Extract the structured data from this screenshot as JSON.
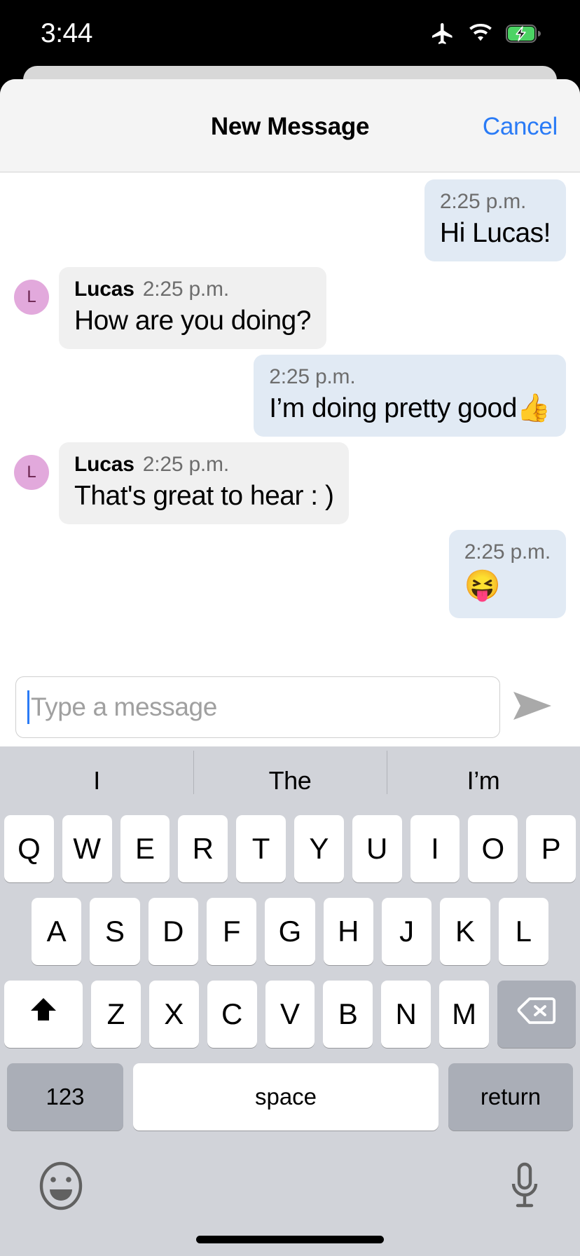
{
  "status_bar": {
    "time": "3:44",
    "icons": [
      "airplane-mode-icon",
      "wifi-icon",
      "battery-charging-icon"
    ],
    "battery_color": "#4cd364"
  },
  "sheet": {
    "title": "New Message",
    "cancel_label": "Cancel",
    "cancel_color": "#2a7bf6"
  },
  "colors": {
    "outgoing_bubble": "#e1eaf4",
    "incoming_bubble": "#f0f0f0",
    "avatar_bg": "#e2a9dc",
    "avatar_fg": "#6b2550",
    "keyboard_bg": "#d1d3d9",
    "key_dark": "#aaaeb7"
  },
  "messages": [
    {
      "direction": "out",
      "sender": "",
      "time": "2:25 p.m.",
      "text": "Hi Lucas!",
      "avatar": ""
    },
    {
      "direction": "in",
      "sender": "Lucas",
      "time": "2:25 p.m.",
      "text": "How are you doing?",
      "avatar": "L"
    },
    {
      "direction": "out",
      "sender": "",
      "time": "2:25 p.m.",
      "text": "I’m doing pretty good👍",
      "avatar": ""
    },
    {
      "direction": "in",
      "sender": "Lucas",
      "time": "2:25 p.m.",
      "text": "That's great to hear : )",
      "avatar": "L"
    },
    {
      "direction": "out",
      "sender": "",
      "time": "2:25 p.m.",
      "text": "😝",
      "avatar": ""
    }
  ],
  "composer": {
    "placeholder": "Type a message",
    "value": "",
    "send_icon": "send-arrow-icon"
  },
  "keyboard": {
    "predictions": [
      "I",
      "The",
      "I’m"
    ],
    "row1": [
      "Q",
      "W",
      "E",
      "R",
      "T",
      "Y",
      "U",
      "I",
      "O",
      "P"
    ],
    "row2": [
      "A",
      "S",
      "D",
      "F",
      "G",
      "H",
      "J",
      "K",
      "L"
    ],
    "row3": [
      "Z",
      "X",
      "C",
      "V",
      "B",
      "N",
      "M"
    ],
    "shift_icon": "shift-arrow-icon",
    "backspace_icon": "backspace-icon",
    "numbers_label": "123",
    "space_label": "space",
    "return_label": "return",
    "emoji_icon": "emoji-face-icon",
    "mic_icon": "microphone-icon"
  }
}
